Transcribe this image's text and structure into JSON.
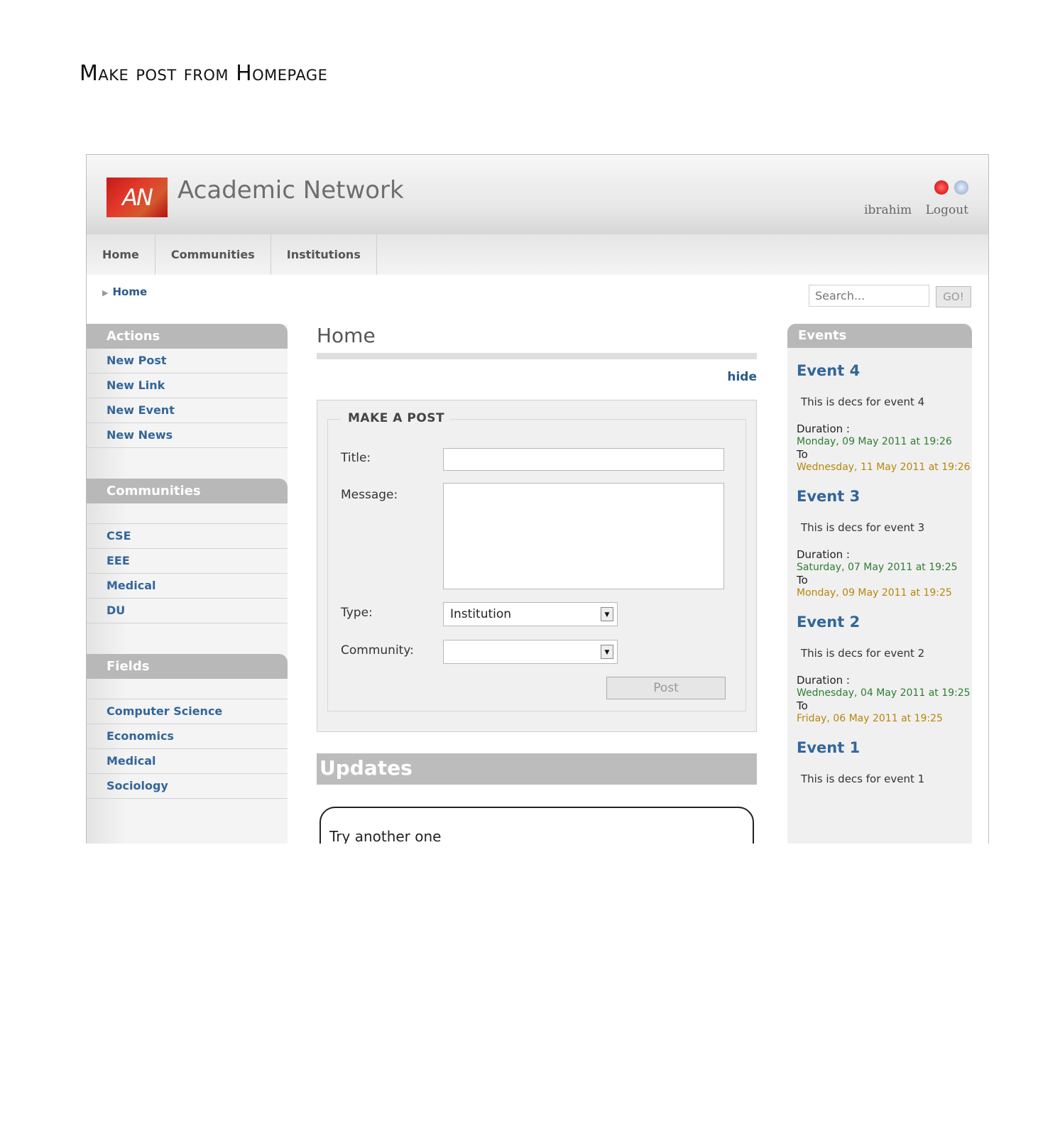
{
  "document_title": "Make post from Homepage",
  "header": {
    "logo_text": "AN",
    "app_title": "Academic Network",
    "user": "ibrahim",
    "logout": "Logout",
    "icons": [
      "power-icon",
      "globe-icon"
    ]
  },
  "nav": {
    "items": [
      "Home",
      "Communities",
      "Institutions"
    ]
  },
  "breadcrumb": "Home",
  "search": {
    "placeholder": "Search...",
    "button": "GO!"
  },
  "sidebar": {
    "actions_title": "Actions",
    "actions": [
      "New Post",
      "New Link",
      "New Event",
      "New News"
    ],
    "communities_title": "Communities",
    "communities": [
      "CSE",
      "EEE",
      "Medical",
      "DU"
    ],
    "fields_title": "Fields",
    "fields": [
      "Computer Science",
      "Economics",
      "Medical",
      "Sociology"
    ]
  },
  "main": {
    "title": "Home",
    "hide_link": "hide",
    "form": {
      "legend": "MAKE A POST",
      "title_label": "Title:",
      "message_label": "Message:",
      "type_label": "Type:",
      "type_value": "Institution",
      "community_label": "Community:",
      "community_value": "",
      "post_button": "Post"
    },
    "updates_title": "Updates",
    "update_preview": "Try another one"
  },
  "events": {
    "title": "Events",
    "duration_label": "Duration :",
    "to_label": "To",
    "items": [
      {
        "title": "Event 4",
        "desc": "This is decs for event 4",
        "start": "Monday, 09 May 2011 at 19:26",
        "end": "Wednesday, 11 May 2011 at 19:26"
      },
      {
        "title": "Event 3",
        "desc": "This is decs for event 3",
        "start": "Saturday, 07 May 2011 at 19:25",
        "end": "Monday, 09 May 2011 at 19:25"
      },
      {
        "title": "Event 2",
        "desc": "This is decs for event 2",
        "start": "Wednesday, 04 May 2011 at 19:25",
        "end": "Friday, 06 May 2011 at 19:25"
      },
      {
        "title": "Event 1",
        "desc": "This is decs for event 1"
      }
    ]
  },
  "colors": {
    "link": "#336699",
    "start_date": "#2e7d32",
    "end_date": "#b8860b",
    "sidebar_header": "#b8b8b8"
  }
}
